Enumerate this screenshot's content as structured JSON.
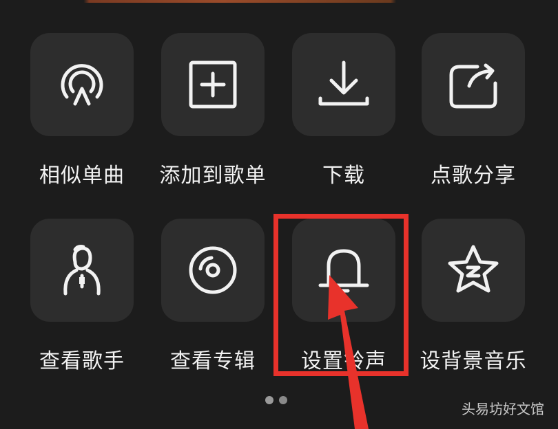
{
  "menu": {
    "row1": [
      {
        "label": "相似单曲",
        "icon": "similar-song-icon"
      },
      {
        "label": "添加到歌单",
        "icon": "add-to-playlist-icon"
      },
      {
        "label": "下载",
        "icon": "download-icon"
      },
      {
        "label": "点歌分享",
        "icon": "share-icon"
      }
    ],
    "row2": [
      {
        "label": "查看歌手",
        "icon": "artist-icon"
      },
      {
        "label": "查看专辑",
        "icon": "album-icon"
      },
      {
        "label": "设置铃声",
        "icon": "bell-icon"
      },
      {
        "label": "设背景音乐",
        "icon": "star-z-icon"
      }
    ]
  },
  "pager": {
    "total": 2,
    "active": 0
  },
  "watermark": "头易坊好文馆",
  "colors": {
    "background": "#1c1c1c",
    "tile": "#2d2d2d",
    "icon_stroke": "#f2f2f2",
    "highlight": "#e8322b"
  }
}
